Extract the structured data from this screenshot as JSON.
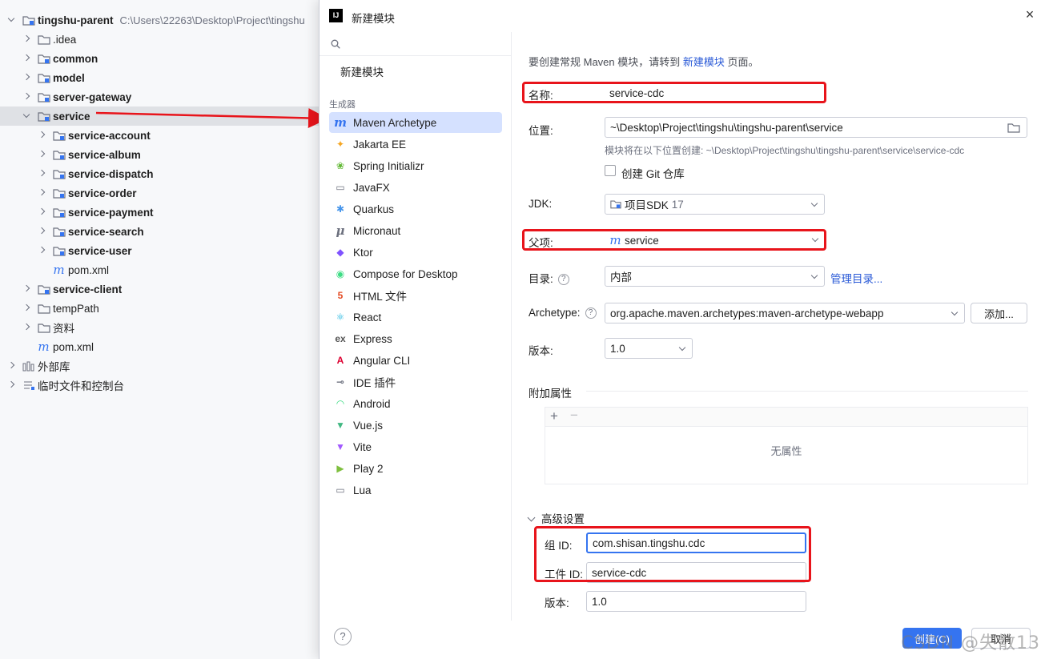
{
  "project_tree": {
    "root": {
      "label": "tingshu-parent",
      "path": "C:\\Users\\22263\\Desktop\\Project\\tingshu"
    },
    "items": [
      {
        "label": ".idea",
        "icon": "folder-icon",
        "expanded": false
      },
      {
        "label": "common",
        "icon": "module-folder-icon",
        "expanded": false
      },
      {
        "label": "model",
        "icon": "module-folder-icon",
        "expanded": false
      },
      {
        "label": "server-gateway",
        "icon": "module-folder-icon",
        "expanded": false
      },
      {
        "label": "service",
        "icon": "module-folder-icon",
        "expanded": true,
        "selected": true
      },
      {
        "label": "service-account",
        "icon": "module-folder-icon",
        "expanded": false
      },
      {
        "label": "service-album",
        "icon": "module-folder-icon",
        "expanded": false
      },
      {
        "label": "service-dispatch",
        "icon": "module-folder-icon",
        "expanded": false
      },
      {
        "label": "service-order",
        "icon": "module-folder-icon",
        "expanded": false
      },
      {
        "label": "service-payment",
        "icon": "module-folder-icon",
        "expanded": false
      },
      {
        "label": "service-search",
        "icon": "module-folder-icon",
        "expanded": false
      },
      {
        "label": "service-user",
        "icon": "module-folder-icon",
        "expanded": false
      },
      {
        "label": "pom.xml",
        "icon": "maven-icon"
      },
      {
        "label": "service-client",
        "icon": "module-folder-icon",
        "expanded": false
      },
      {
        "label": "tempPath",
        "icon": "folder-icon",
        "expanded": false
      },
      {
        "label": "资料",
        "icon": "folder-icon",
        "expanded": false
      },
      {
        "label": "pom.xml",
        "icon": "maven-icon"
      },
      {
        "label": "外部库",
        "icon": "library-icon",
        "expanded": false
      },
      {
        "label": "临时文件和控制台",
        "icon": "scratch-icon",
        "expanded": false
      }
    ]
  },
  "dialog": {
    "title": "新建模块",
    "left_panel": {
      "search_placeholder": "",
      "new_module": "新建模块",
      "generators_header": "生成器",
      "generators": [
        {
          "label": "Maven Archetype",
          "icon": "maven-icon",
          "selected": true
        },
        {
          "label": "Jakarta EE",
          "icon": "jakarta-icon"
        },
        {
          "label": "Spring Initializr",
          "icon": "spring-icon"
        },
        {
          "label": "JavaFX",
          "icon": "javafx-icon"
        },
        {
          "label": "Quarkus",
          "icon": "quarkus-icon"
        },
        {
          "label": "Micronaut",
          "icon": "micronaut-icon"
        },
        {
          "label": "Ktor",
          "icon": "ktor-icon"
        },
        {
          "label": "Compose for Desktop",
          "icon": "compose-icon"
        },
        {
          "label": "HTML 文件",
          "icon": "html5-icon"
        },
        {
          "label": "React",
          "icon": "react-icon"
        },
        {
          "label": "Express",
          "icon": "express-icon"
        },
        {
          "label": "Angular CLI",
          "icon": "angular-icon"
        },
        {
          "label": "IDE 插件",
          "icon": "plugin-icon"
        },
        {
          "label": "Android",
          "icon": "android-icon"
        },
        {
          "label": "Vue.js",
          "icon": "vue-icon"
        },
        {
          "label": "Vite",
          "icon": "vite-icon"
        },
        {
          "label": "Play 2",
          "icon": "play-icon"
        },
        {
          "label": "Lua",
          "icon": "lua-icon"
        }
      ]
    },
    "form": {
      "info_prefix": "要创建常规 Maven 模块，请转到 ",
      "info_link": "新建模块",
      "info_suffix": " 页面。",
      "name_label": "名称:",
      "name_value": "service-cdc",
      "location_label": "位置:",
      "location_value": "~\\Desktop\\Project\\tingshu\\tingshu-parent\\service",
      "location_hint": "模块将在以下位置创建: ~\\Desktop\\Project\\tingshu\\tingshu-parent\\service\\service-cdc",
      "git_label": "创建 Git 仓库",
      "jdk_label": "JDK:",
      "jdk_value": "项目SDK",
      "jdk_version": "17",
      "parent_label": "父项:",
      "parent_value": "service",
      "catalog_label": "目录:",
      "catalog_value": "内部",
      "catalog_link": "管理目录...",
      "archetype_label": "Archetype:",
      "archetype_value": "org.apache.maven.archetypes:maven-archetype-webapp",
      "add_button": "添加...",
      "version_label": "版本:",
      "version_value": "1.0",
      "props_header": "附加属性",
      "props_empty": "无属性",
      "advanced_label": "高级设置",
      "group_id_label": "组 ID:",
      "group_id_value": "com.shisan.tingshu.cdc",
      "artifact_id_label": "工件 ID:",
      "artifact_id_value": "service-cdc",
      "adv_version_label": "版本:",
      "adv_version_value": "1.0"
    },
    "footer": {
      "create_button": "创建(C)",
      "cancel_button": "取消",
      "help_icon": "?"
    }
  },
  "watermark": "CSDN @失散13",
  "colors": {
    "accent": "#3574f0",
    "highlight_box": "#e8141b",
    "selection": "#d5e1ff"
  }
}
